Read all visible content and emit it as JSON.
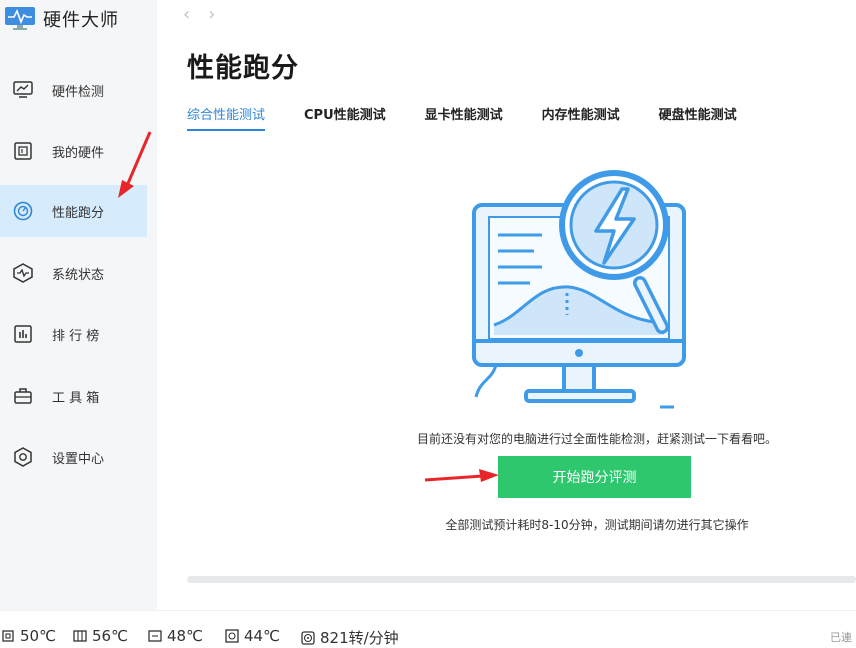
{
  "app": {
    "title": "硬件大师"
  },
  "sidebar": {
    "items": [
      {
        "label": "硬件检测",
        "icon": "monitor-chart-icon"
      },
      {
        "label": "我的硬件",
        "icon": "board-icon"
      },
      {
        "label": "性能跑分",
        "icon": "speedometer-icon",
        "active": true
      },
      {
        "label": "系统状态",
        "icon": "heartbeat-icon"
      },
      {
        "label": "排 行 榜",
        "icon": "ranking-icon"
      },
      {
        "label": "工 具 箱",
        "icon": "toolbox-icon"
      },
      {
        "label": "设置中心",
        "icon": "settings-hex-icon"
      }
    ]
  },
  "nav": {
    "back": "‹",
    "forward": "›"
  },
  "main": {
    "title": "性能跑分",
    "tabs": [
      {
        "label": "综合性能测试",
        "active": true
      },
      {
        "label": "CPU性能测试"
      },
      {
        "label": "显卡性能测试"
      },
      {
        "label": "内存性能测试"
      },
      {
        "label": "硬盘性能测试"
      }
    ],
    "description": "目前还没有对您的电脑进行过全面性能检测，赶紧测试一下看看吧。",
    "start_button": "开始跑分评测",
    "note": "全部测试预计耗时8-10分钟，测试期间请勿进行其它操作"
  },
  "status": {
    "items": [
      {
        "value": "50℃",
        "icon": "cpu-temp-icon"
      },
      {
        "value": "56℃",
        "icon": "gpu-temp-icon"
      },
      {
        "value": "48℃",
        "icon": "board-temp-icon"
      },
      {
        "value": "44℃",
        "icon": "disk-temp-icon"
      },
      {
        "value": "821转/分钟",
        "icon": "fan-icon"
      }
    ],
    "right_text": "已連"
  },
  "colors": {
    "accent": "#2f86d6",
    "start": "#2ec76e",
    "active_bg": "#d6ebfb",
    "arrow": "#e8262a"
  }
}
